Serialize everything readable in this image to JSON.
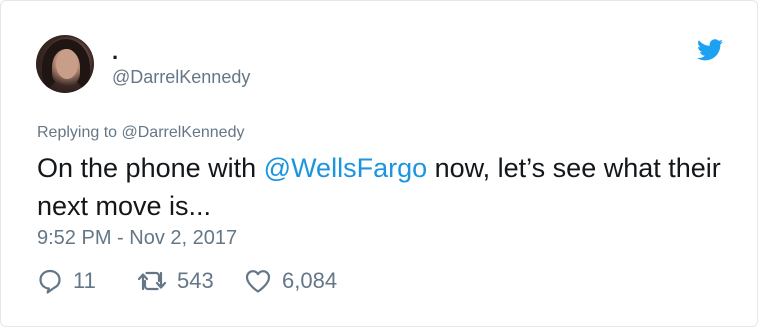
{
  "tweet": {
    "display_name": ".",
    "handle": "@DarrelKennedy",
    "replying_prefix": "Replying to ",
    "replying_to": "@DarrelKennedy",
    "text_before": "On the phone with ",
    "text_mention": "@WellsFargo",
    "text_after": " now, let’s see what their next move is...",
    "timestamp": "9:52 PM - Nov 2, 2017"
  },
  "actions": {
    "replies": "11",
    "retweets": "543",
    "likes": "6,084"
  },
  "icons": {
    "brand": "twitter-bird-icon",
    "reply": "reply-icon",
    "retweet": "retweet-icon",
    "like": "heart-icon"
  },
  "colors": {
    "brand_blue": "#1da1f2",
    "link_blue": "#1b95e0",
    "muted_gray": "#657786",
    "text_dark": "#14171a"
  }
}
